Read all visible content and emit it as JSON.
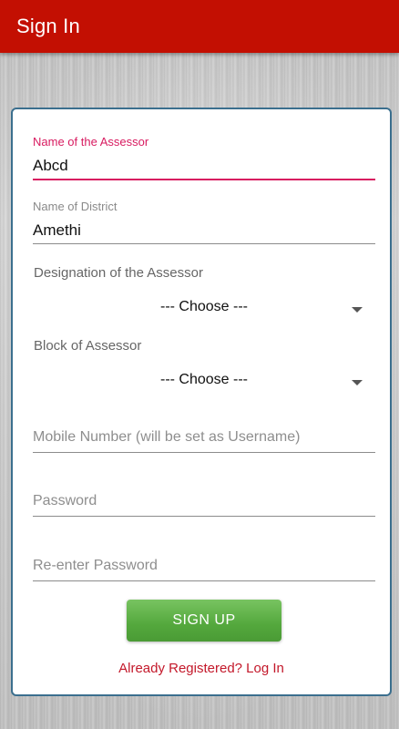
{
  "app_bar": {
    "title": "Sign In"
  },
  "form": {
    "assessor_name": {
      "label": "Name of the Assessor",
      "value": "Abcd"
    },
    "district": {
      "label": "Name of District",
      "value": "Amethi"
    },
    "designation": {
      "label": "Designation of the Assessor",
      "selected": "--- Choose ---"
    },
    "block": {
      "label": "Block of Assessor",
      "selected": "--- Choose ---"
    },
    "mobile": {
      "placeholder": "Mobile Number (will be set as Username)"
    },
    "password": {
      "placeholder": "Password"
    },
    "reenter_password": {
      "placeholder": "Re-enter Password"
    },
    "signup_label": "SIGN UP",
    "login_link": "Already Registered? Log In"
  },
  "colors": {
    "app_bar": "#c30f02",
    "accent": "#d81b60",
    "button": "#54a83d",
    "link": "#c3182a",
    "card_border": "#3b6f8e"
  }
}
